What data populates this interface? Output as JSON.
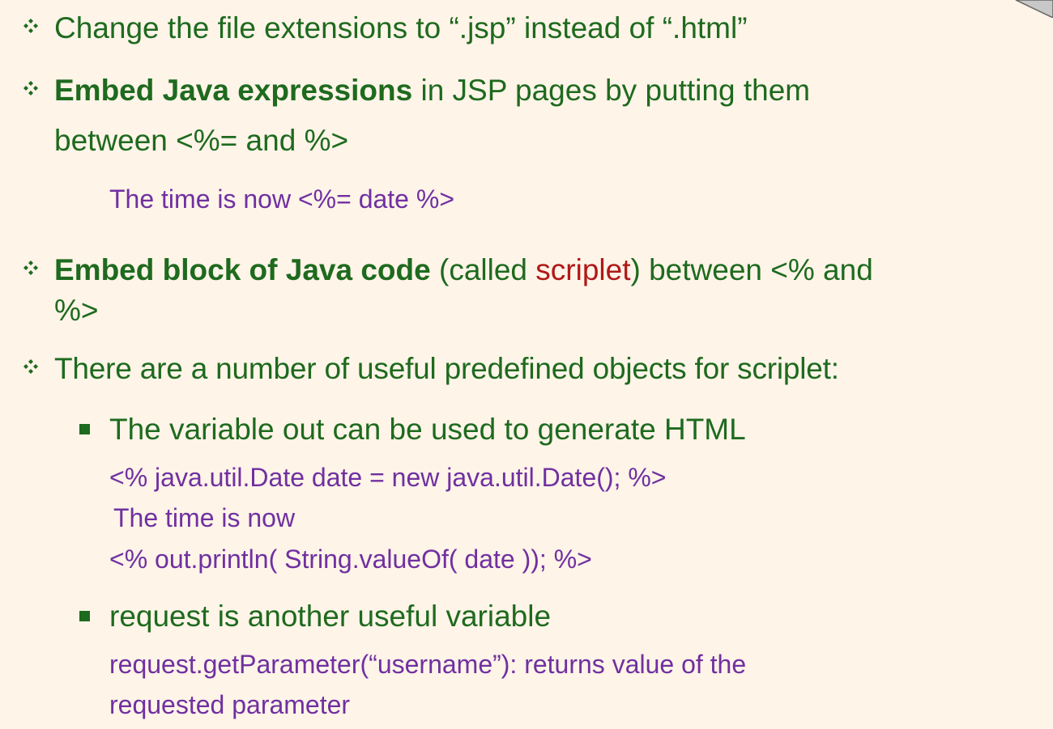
{
  "bullets": {
    "item1": {
      "text": "Change the file extensions to “.jsp” instead of “.html”"
    },
    "item2": {
      "bold": "Embed Java expressions",
      "rest": " in JSP pages by putting them",
      "continuation": "between <%= and %>",
      "example": "The time is now <%= date %>"
    },
    "item3": {
      "bold": "Embed block of Java code",
      "pre_accent": " (called ",
      "accent": "scriplet",
      "post_accent": ") between <% and",
      "continuation": "%>"
    },
    "item4": {
      "text": "There are a number of useful predefined objects for scriplet:"
    },
    "sub1": {
      "text": "The variable out can be used to generate HTML",
      "code_line1": "<%   java.util.Date  date = new  java.util.Date();   %>",
      "code_line2": "The time is now",
      "code_line3": "<%   out.println( String.valueOf( date ));    %>"
    },
    "sub2": {
      "text": "request is another useful variable",
      "code_line1": "request.getParameter(“username”):  returns value of the",
      "code_line2": "requested parameter"
    }
  },
  "colors": {
    "background": "#fef4e8",
    "text_green": "#1e6a1e",
    "code_purple": "#7030a0",
    "accent_red": "#b01818"
  },
  "icons": {
    "level1_bullet": "four-diamond-icon",
    "level2_bullet": "square-bullet-icon"
  }
}
